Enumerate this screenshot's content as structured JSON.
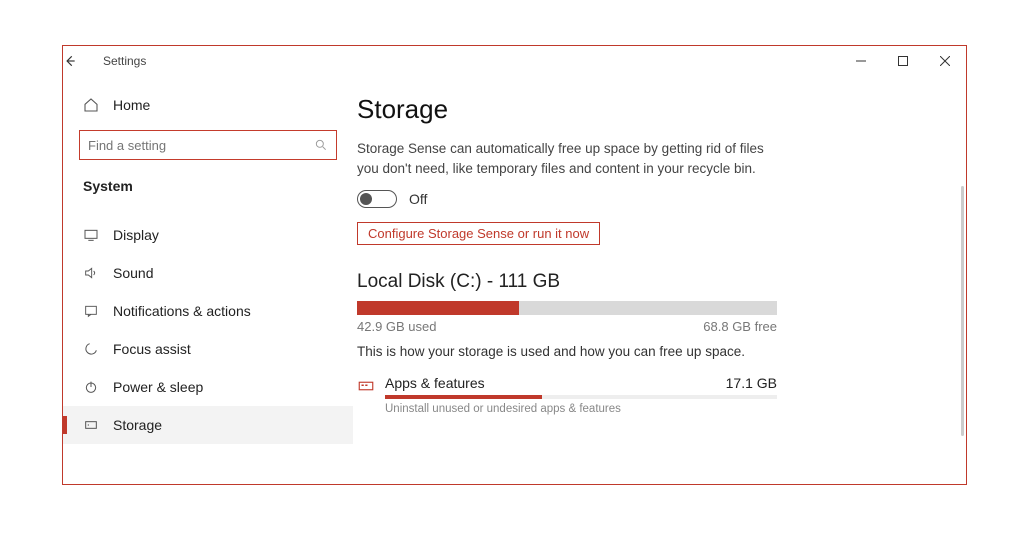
{
  "window": {
    "title": "Settings"
  },
  "sidebar": {
    "home_label": "Home",
    "search_placeholder": "Find a setting",
    "section_label": "System",
    "items": [
      {
        "label": "Display"
      },
      {
        "label": "Sound"
      },
      {
        "label": "Notifications & actions"
      },
      {
        "label": "Focus assist"
      },
      {
        "label": "Power & sleep"
      },
      {
        "label": "Storage"
      }
    ]
  },
  "main": {
    "title": "Storage",
    "sense_desc": "Storage Sense can automatically free up space by getting rid of files you don't need, like temporary files and content in your recycle bin.",
    "toggle_state": "Off",
    "configure_link": "Configure Storage Sense or run it now",
    "disk_title": "Local Disk (C:) - 111 GB",
    "used_label": "42.9 GB used",
    "free_label": "68.8 GB free",
    "used_pct": 38.6,
    "usage_desc": "This is how your storage is used and how you can free up space.",
    "category": {
      "name": "Apps & features",
      "size": "17.1 GB",
      "sub": "Uninstall unused or undesired apps & features",
      "pct": 40
    }
  }
}
